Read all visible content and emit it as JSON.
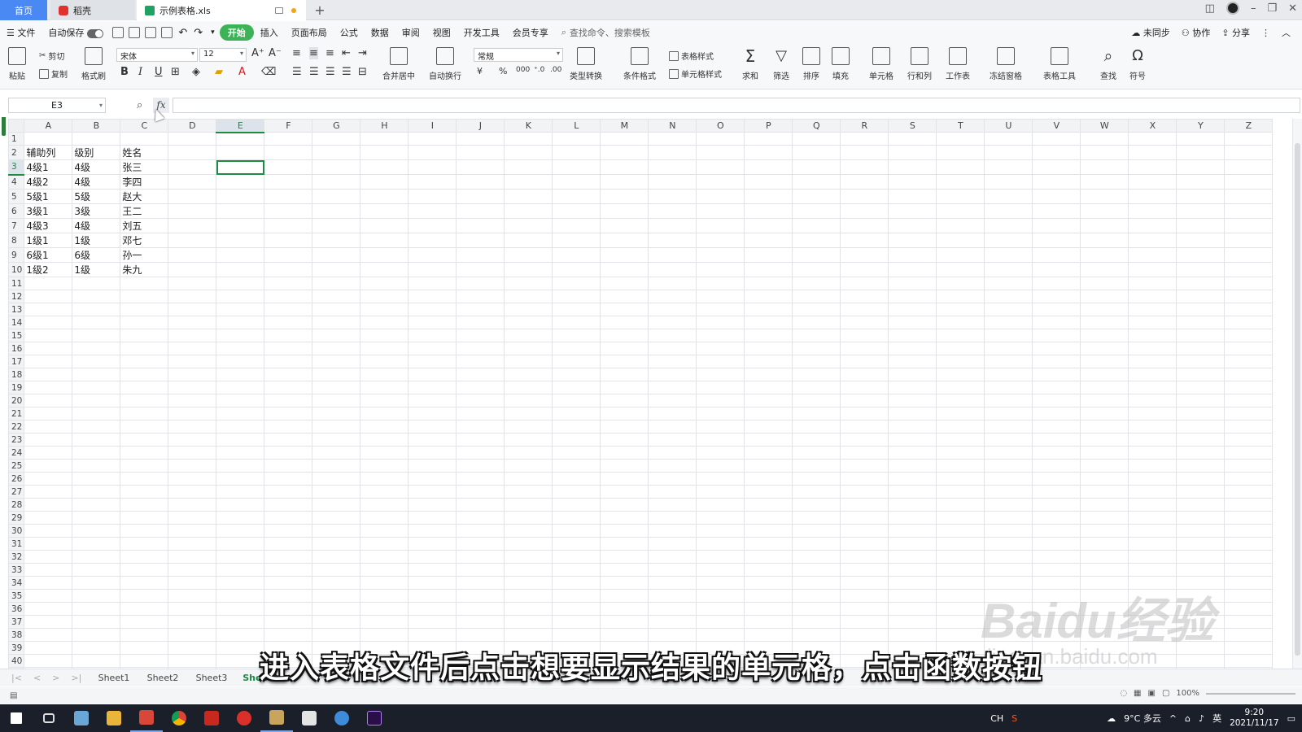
{
  "tabs": {
    "home": "首页",
    "daoke": "稻壳",
    "file": "示例表格.xls",
    "add": "+"
  },
  "menu": {
    "file": "文件",
    "autosave": "自动保存",
    "items": [
      "开始",
      "插入",
      "页面布局",
      "公式",
      "数据",
      "审阅",
      "视图",
      "开发工具",
      "会员专享"
    ],
    "search_placeholder": "查找命令、搜索模板",
    "unsynced": "未同步",
    "collab": "协作",
    "share": "分享"
  },
  "ribbon": {
    "paste": "粘贴",
    "cut": "剪切",
    "copy": "复制",
    "format_painter": "格式刷",
    "font_name": "宋体",
    "font_size": "12",
    "merge": "合并居中",
    "wrap": "自动换行",
    "number_format": "常规",
    "type_convert": "类型转换",
    "cond_format": "条件格式",
    "table_style": "表格样式",
    "cell_style": "单元格样式",
    "sum": "求和",
    "filter": "筛选",
    "sort": "排序",
    "fill": "填充",
    "cell": "单元格",
    "row_col": "行和列",
    "worksheet": "工作表",
    "freeze": "冻结窗格",
    "table_tools": "表格工具",
    "find": "查找",
    "symbol": "符号"
  },
  "formula_bar": {
    "name_box": "E3",
    "fx": "fx",
    "formula": ""
  },
  "columns": [
    "A",
    "B",
    "C",
    "D",
    "E",
    "F",
    "G",
    "H",
    "I",
    "J",
    "K",
    "L",
    "M",
    "N",
    "O",
    "P",
    "Q",
    "R",
    "S",
    "T",
    "U",
    "V",
    "W",
    "X",
    "Y",
    "Z"
  ],
  "selected_column": "E",
  "selected_row": 3,
  "rows": [
    [
      "",
      "",
      ""
    ],
    [
      "辅助列",
      "级别",
      "姓名"
    ],
    [
      "4级1",
      "4级",
      "张三"
    ],
    [
      "4级2",
      "4级",
      "李四"
    ],
    [
      "5级1",
      "5级",
      "赵大"
    ],
    [
      "3级1",
      "3级",
      "王二"
    ],
    [
      "4级3",
      "4级",
      "刘五"
    ],
    [
      "1级1",
      "1级",
      "邓七"
    ],
    [
      "6级1",
      "6级",
      "孙一"
    ],
    [
      "1级2",
      "1级",
      "朱九"
    ]
  ],
  "total_rows": 42,
  "sheets": [
    "Sheet1",
    "Sheet2",
    "Sheet3",
    "Sheet4"
  ],
  "active_sheet": "Sheet4",
  "status": {
    "zoom": "100%"
  },
  "taskbar": {
    "weather": "9°C 多云",
    "ime1": "CH",
    "ime2": "英",
    "time": "9:20",
    "date": "2021/11/17"
  },
  "subtitle": "进入表格文件后点击想要显示结果的单元格，点击函数按钮",
  "watermark": {
    "main": "Baidu经验",
    "sub": "jingyan.baidu.com"
  },
  "colors": {
    "accent_green": "#1f8a45",
    "tab_blue": "#4a89f3",
    "start_btn": "#3bb356"
  }
}
